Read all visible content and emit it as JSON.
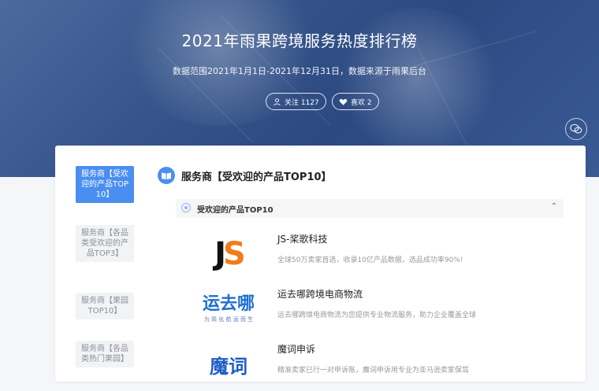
{
  "hero": {
    "title": "2021年雨果跨境服务热度排行榜",
    "subtitle": "数据范围2021年1月1日-2021年12月31日，数据来源于雨果后台",
    "follow_label": "关注 1127",
    "like_label": "喜欢 2"
  },
  "sidebar": {
    "items": [
      {
        "label": "服务商【受欢迎的产品TOP10】",
        "active": true
      },
      {
        "label": "服务商【各品类受欢迎的产品TOP3】",
        "active": false
      },
      {
        "label": "服务商【果园TOP10】",
        "active": false
      },
      {
        "label": "服务商【各品类热门果园】",
        "active": false
      }
    ]
  },
  "section": {
    "title": "服务商【受欢迎的产品TOP10】",
    "subsection_title": "受欢迎的产品TOP10"
  },
  "items": [
    {
      "name": "JS-桨歌科技",
      "desc": "全球50万卖家首选，收录10亿产品数据，选品成功率90%!",
      "logo_text": "JS"
    },
    {
      "name": "运去哪跨境电商物流",
      "desc": "运去哪跨境电商物流为您提供专业物流服务，助力企业覆盖全球",
      "logo_text": "运去哪",
      "logo_sub": "为 简 化 航 运 而 生"
    },
    {
      "name": "魔词申诉",
      "desc": "精准卖家已行一对申诉账，魔词申诉用专业为亚马逊卖家保驾",
      "logo_text": "魔词"
    }
  ],
  "colors": {
    "accent": "#4a8ef0",
    "hero": "#35548a",
    "js_orange": "#f07d1a",
    "yqn_blue": "#1f6fd1"
  }
}
